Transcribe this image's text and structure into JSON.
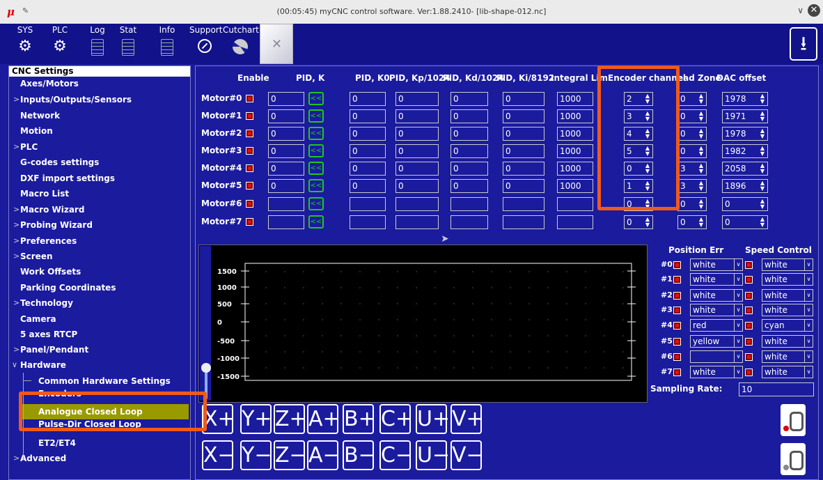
{
  "window": {
    "title": "(00:05:45) myCNC control software. Ver:1.88.2410- [lib-shape-012.nc]"
  },
  "toolbar": {
    "buttons": [
      {
        "label": "SYS",
        "icon": "gear-icon"
      },
      {
        "label": "PLC",
        "icon": "gear-icon"
      },
      {
        "label": "Log",
        "icon": "document-icon"
      },
      {
        "label": "Stat",
        "icon": "document-icon"
      },
      {
        "label": "Info",
        "icon": "document-icon"
      },
      {
        "label": "Support",
        "icon": "support-icon"
      },
      {
        "label": "Cutchart",
        "icon": "cutchart-icon"
      }
    ]
  },
  "sidebar": {
    "header": "CNC Settings",
    "items": [
      {
        "label": "Axes/Motors",
        "expandable": false,
        "level": 0
      },
      {
        "label": "Inputs/Outputs/Sensors",
        "expandable": true,
        "level": 0
      },
      {
        "label": "Network",
        "expandable": false,
        "level": 0
      },
      {
        "label": "Motion",
        "expandable": false,
        "level": 0
      },
      {
        "label": "PLC",
        "expandable": true,
        "level": 0
      },
      {
        "label": "G-codes settings",
        "expandable": false,
        "level": 0
      },
      {
        "label": "DXF import settings",
        "expandable": false,
        "level": 0
      },
      {
        "label": "Macro List",
        "expandable": false,
        "level": 0
      },
      {
        "label": "Macro Wizard",
        "expandable": true,
        "level": 0
      },
      {
        "label": "Probing Wizard",
        "expandable": true,
        "level": 0
      },
      {
        "label": "Preferences",
        "expandable": true,
        "level": 0
      },
      {
        "label": "Screen",
        "expandable": true,
        "level": 0
      },
      {
        "label": "Work Offsets",
        "expandable": false,
        "level": 0
      },
      {
        "label": "Parking Coordinates",
        "expandable": false,
        "level": 0
      },
      {
        "label": "Technology",
        "expandable": true,
        "level": 0
      },
      {
        "label": "Camera",
        "expandable": false,
        "level": 0
      },
      {
        "label": "5 axes RTCP",
        "expandable": false,
        "level": 0
      },
      {
        "label": "Panel/Pendant",
        "expandable": true,
        "level": 0
      },
      {
        "label": "Hardware",
        "expandable": true,
        "level": 0
      },
      {
        "label": "Common Hardware Settings",
        "expandable": false,
        "level": 1
      },
      {
        "label": "Encoders",
        "expandable": false,
        "level": 1
      },
      {
        "label": "Analogue Closed Loop",
        "expandable": false,
        "level": 1,
        "selected": true
      },
      {
        "label": "Pulse-Dir Closed Loop",
        "expandable": false,
        "level": 1
      },
      {
        "label": "ET2/ET4",
        "expandable": false,
        "level": 1
      },
      {
        "label": "Advanced",
        "expandable": true,
        "level": 0
      }
    ]
  },
  "table": {
    "headers": {
      "enable": "Enable",
      "pid_k": "PID, K",
      "pid_k0": "PID, K0",
      "pid_kp": "PID, Kp/1024",
      "pid_kd": "PID, Kd/1024",
      "pid_ki": "PID, Ki/8192",
      "integral_limit": "Integral Lim",
      "encoder_channel": "Encoder channel",
      "dead_zone": "ead Zone",
      "dac_offset": "DAC offset"
    },
    "rows": [
      {
        "motor": "Motor#0",
        "pid_k": "0",
        "pid_k0": "0",
        "kp": "0",
        "kd": "0",
        "ki": "0",
        "integral_limit": "1000",
        "encoder": "2",
        "dead_zone": "0",
        "dac_offset": "1978"
      },
      {
        "motor": "Motor#1",
        "pid_k": "0",
        "pid_k0": "0",
        "kp": "0",
        "kd": "0",
        "ki": "0",
        "integral_limit": "1000",
        "encoder": "3",
        "dead_zone": "0",
        "dac_offset": "1971"
      },
      {
        "motor": "Motor#2",
        "pid_k": "0",
        "pid_k0": "0",
        "kp": "0",
        "kd": "0",
        "ki": "0",
        "integral_limit": "1000",
        "encoder": "4",
        "dead_zone": "0",
        "dac_offset": "1978"
      },
      {
        "motor": "Motor#3",
        "pid_k": "0",
        "pid_k0": "0",
        "kp": "0",
        "kd": "0",
        "ki": "0",
        "integral_limit": "1000",
        "encoder": "5",
        "dead_zone": "0",
        "dac_offset": "1982"
      },
      {
        "motor": "Motor#4",
        "pid_k": "0",
        "pid_k0": "0",
        "kp": "0",
        "kd": "0",
        "ki": "0",
        "integral_limit": "1000",
        "encoder": "0",
        "dead_zone": "3",
        "dac_offset": "2058"
      },
      {
        "motor": "Motor#5",
        "pid_k": "0",
        "pid_k0": "0",
        "kp": "0",
        "kd": "0",
        "ki": "0",
        "integral_limit": "1000",
        "encoder": "1",
        "dead_zone": "3",
        "dac_offset": "1896"
      },
      {
        "motor": "Motor#6",
        "pid_k": "",
        "pid_k0": "",
        "kp": "",
        "kd": "",
        "ki": "",
        "integral_limit": "",
        "encoder": "0",
        "dead_zone": "0",
        "dac_offset": "0"
      },
      {
        "motor": "Motor#7",
        "pid_k": "",
        "pid_k0": "",
        "kp": "",
        "kd": "",
        "ki": "",
        "integral_limit": "",
        "encoder": "0",
        "dead_zone": "0",
        "dac_offset": "0"
      }
    ],
    "pid_button_label": "<<"
  },
  "chart": {
    "y_ticks": [
      "1500",
      "1000",
      "500",
      "0",
      "-500",
      "-1000",
      "-1500"
    ]
  },
  "legend": {
    "position_err_header": "Position Err",
    "speed_control_header": "Speed Control",
    "rows": [
      {
        "num": "#0",
        "pos_color": "white",
        "speed_color": "white"
      },
      {
        "num": "#1",
        "pos_color": "white",
        "speed_color": "white"
      },
      {
        "num": "#2",
        "pos_color": "white",
        "speed_color": "white"
      },
      {
        "num": "#3",
        "pos_color": "white",
        "speed_color": "white"
      },
      {
        "num": "#4",
        "pos_color": "red",
        "speed_color": "cyan"
      },
      {
        "num": "#5",
        "pos_color": "yellow",
        "speed_color": "white"
      },
      {
        "num": "#6",
        "pos_color": "",
        "speed_color": "white"
      },
      {
        "num": "#7",
        "pos_color": "white",
        "speed_color": "white"
      }
    ],
    "sampling_label": "Sampling Rate:",
    "sampling_value": "10"
  },
  "jog": {
    "plus": [
      "X+",
      "Y+",
      "Z+",
      "A+",
      "B+",
      "C+",
      "U+",
      "V+"
    ],
    "minus": [
      "X−",
      "Y−",
      "Z−",
      "A−",
      "B−",
      "C−",
      "U−",
      "V−"
    ]
  },
  "colors": {
    "background": "#1b1b9e",
    "highlight": "#f05a1a",
    "selected_item": "#999900",
    "pid_button": "#1ec81e"
  }
}
